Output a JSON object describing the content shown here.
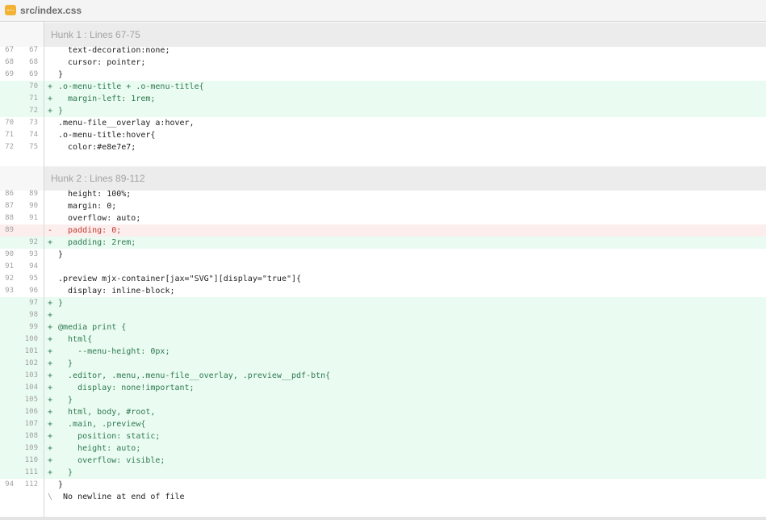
{
  "file": {
    "name": "src/index.css",
    "icon": "css-file-icon"
  },
  "hunks": [
    {
      "label": "Hunk 1 : Lines 67-75"
    },
    {
      "label": "Hunk 2 : Lines 89-112"
    }
  ],
  "hunk1_lines": [
    {
      "old": "67",
      "new": "67",
      "sign": "",
      "type": "ctx",
      "text": "  text-decoration:none;"
    },
    {
      "old": "68",
      "new": "68",
      "sign": "",
      "type": "ctx",
      "text": "  cursor: pointer;"
    },
    {
      "old": "69",
      "new": "69",
      "sign": "",
      "type": "ctx",
      "text": "}"
    },
    {
      "old": "",
      "new": "70",
      "sign": "+",
      "type": "add",
      "text": ".o-menu-title + .o-menu-title{"
    },
    {
      "old": "",
      "new": "71",
      "sign": "+",
      "type": "add",
      "text": "  margin-left: 1rem;"
    },
    {
      "old": "",
      "new": "72",
      "sign": "+",
      "type": "add",
      "text": "}"
    },
    {
      "old": "70",
      "new": "73",
      "sign": "",
      "type": "ctx",
      "text": ".menu-file__overlay a:hover,"
    },
    {
      "old": "71",
      "new": "74",
      "sign": "",
      "type": "ctx",
      "text": ".o-menu-title:hover{"
    },
    {
      "old": "72",
      "new": "75",
      "sign": "",
      "type": "ctx",
      "text": "  color:#e8e7e7;"
    }
  ],
  "hunk2_lines": [
    {
      "old": "86",
      "new": "89",
      "sign": "",
      "type": "ctx",
      "text": "  height: 100%;"
    },
    {
      "old": "87",
      "new": "90",
      "sign": "",
      "type": "ctx",
      "text": "  margin: 0;"
    },
    {
      "old": "88",
      "new": "91",
      "sign": "",
      "type": "ctx",
      "text": "  overflow: auto;"
    },
    {
      "old": "89",
      "new": "",
      "sign": "-",
      "type": "del",
      "text": "  padding: 0;"
    },
    {
      "old": "",
      "new": "92",
      "sign": "+",
      "type": "add",
      "text": "  padding: 2rem;"
    },
    {
      "old": "90",
      "new": "93",
      "sign": "",
      "type": "ctx",
      "text": "}"
    },
    {
      "old": "91",
      "new": "94",
      "sign": "",
      "type": "ctx",
      "text": ""
    },
    {
      "old": "92",
      "new": "95",
      "sign": "",
      "type": "ctx",
      "text": ".preview mjx-container[jax=\"SVG\"][display=\"true\"]{"
    },
    {
      "old": "93",
      "new": "96",
      "sign": "",
      "type": "ctx",
      "text": "  display: inline-block;"
    },
    {
      "old": "",
      "new": "97",
      "sign": "+",
      "type": "add",
      "text": "}"
    },
    {
      "old": "",
      "new": "98",
      "sign": "+",
      "type": "add",
      "text": ""
    },
    {
      "old": "",
      "new": "99",
      "sign": "+",
      "type": "add",
      "text": "@media print {"
    },
    {
      "old": "",
      "new": "100",
      "sign": "+",
      "type": "add",
      "text": "  html{"
    },
    {
      "old": "",
      "new": "101",
      "sign": "+",
      "type": "add",
      "text": "    --menu-height: 0px;"
    },
    {
      "old": "",
      "new": "102",
      "sign": "+",
      "type": "add",
      "text": "  }"
    },
    {
      "old": "",
      "new": "103",
      "sign": "+",
      "type": "add",
      "text": "  .editor, .menu,.menu-file__overlay, .preview__pdf-btn{"
    },
    {
      "old": "",
      "new": "104",
      "sign": "+",
      "type": "add",
      "text": "    display: none!important;"
    },
    {
      "old": "",
      "new": "105",
      "sign": "+",
      "type": "add",
      "text": "  }"
    },
    {
      "old": "",
      "new": "106",
      "sign": "+",
      "type": "add",
      "text": "  html, body, #root,"
    },
    {
      "old": "",
      "new": "107",
      "sign": "+",
      "type": "add",
      "text": "  .main, .preview{"
    },
    {
      "old": "",
      "new": "108",
      "sign": "+",
      "type": "add",
      "text": "    position: static;"
    },
    {
      "old": "",
      "new": "109",
      "sign": "+",
      "type": "add",
      "text": "    height: auto;"
    },
    {
      "old": "",
      "new": "110",
      "sign": "+",
      "type": "add",
      "text": "    overflow: visible;"
    },
    {
      "old": "",
      "new": "111",
      "sign": "+",
      "type": "add",
      "text": "  }"
    },
    {
      "old": "94",
      "new": "112",
      "sign": "",
      "type": "ctx",
      "text": "}"
    },
    {
      "old": "",
      "new": "",
      "sign": "\\",
      "type": "ctx",
      "text": " No newline at end of file"
    }
  ]
}
